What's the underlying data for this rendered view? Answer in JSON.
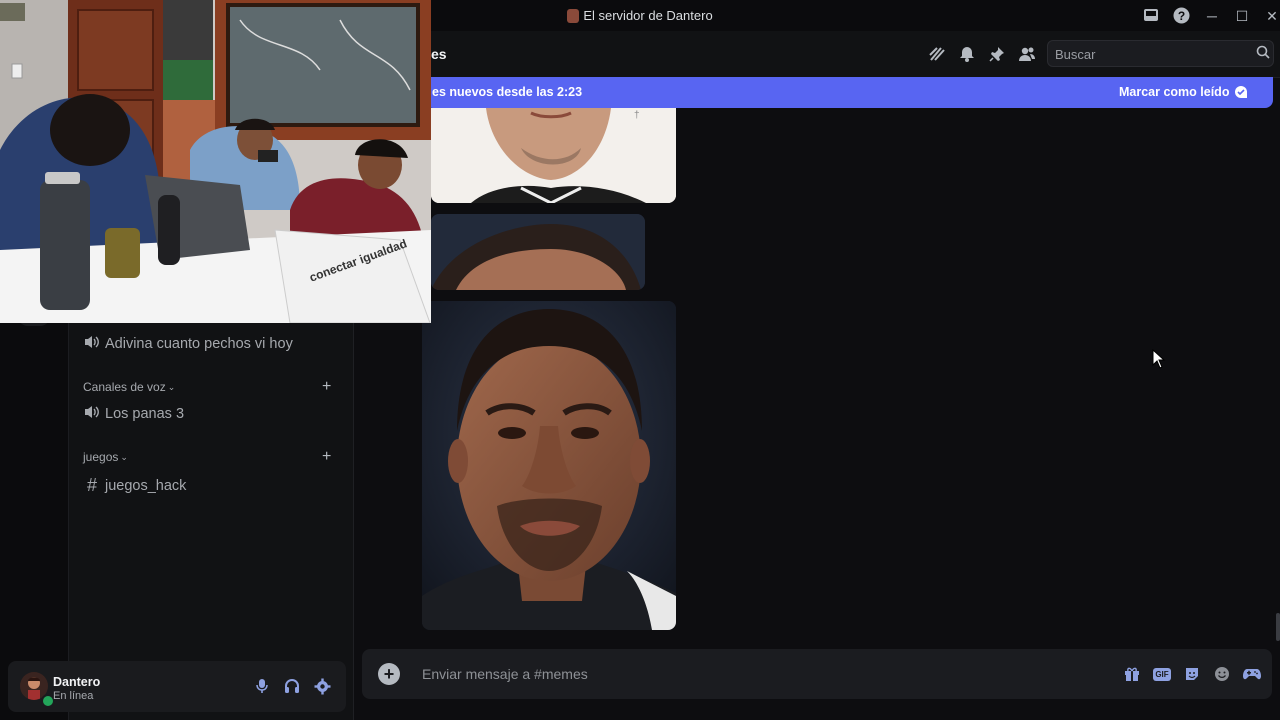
{
  "window": {
    "title": "El servidor de Dantero",
    "controls": {
      "minimize": "─",
      "maximize": "☐",
      "close": "✕"
    }
  },
  "sidebar": {
    "channels_top": [
      {
        "icon": "speaker-icon",
        "label": "Adivina cuanto pechos vi hoy"
      }
    ],
    "categories": [
      {
        "label": "Canales de voz",
        "channels": [
          {
            "icon": "speaker-icon",
            "label": "Los panas 3"
          }
        ]
      },
      {
        "label": "juegos",
        "channels": [
          {
            "icon": "hash-icon",
            "label": "juegos_hack"
          }
        ]
      }
    ]
  },
  "user": {
    "name": "Dantero",
    "status": "En línea"
  },
  "header": {
    "channel": "es",
    "search_placeholder": "Buscar"
  },
  "banner": {
    "text": "es nuevos desde las 2:23",
    "action": "Marcar como leído"
  },
  "composer": {
    "placeholder": "Enviar mensaje a #memes",
    "gif_label": "GIF"
  },
  "webcam": {
    "laptop_sticker": "conectar igualdad"
  }
}
